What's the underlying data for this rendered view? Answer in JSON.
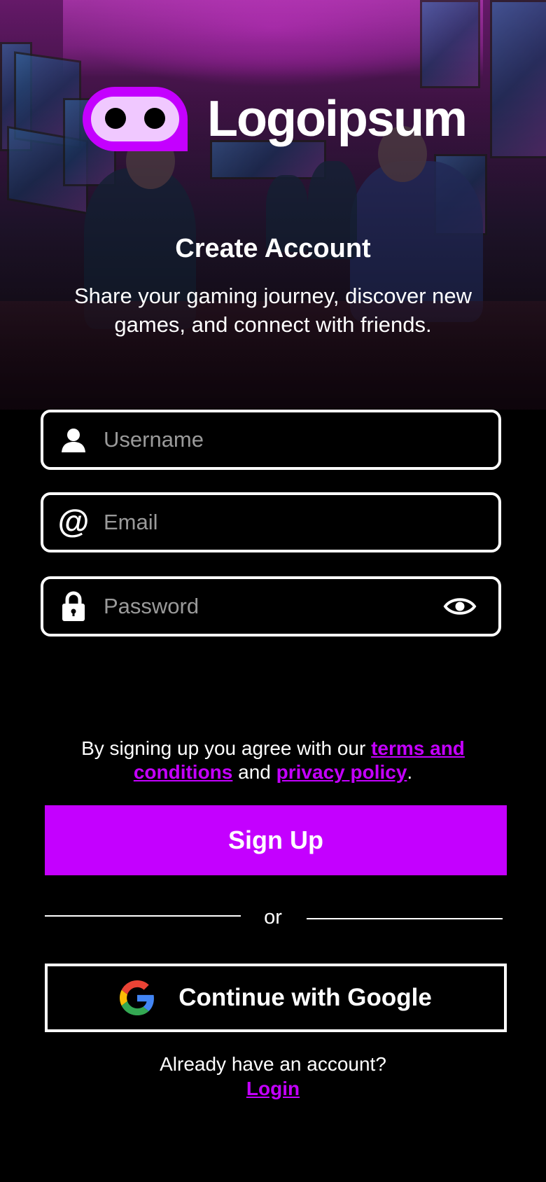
{
  "brand": {
    "name": "Logoipsum",
    "accent_color": "#c400ff",
    "logo_icon": "logo-mascot-icon"
  },
  "header": {
    "title": "Create Account",
    "subtitle": "Share your gaming journey, discover new games, and connect with friends."
  },
  "form": {
    "username": {
      "placeholder": "Username",
      "value": "",
      "icon": "user-icon"
    },
    "email": {
      "placeholder": "Email",
      "value": "",
      "icon": "at-icon"
    },
    "password": {
      "placeholder": "Password",
      "value": "",
      "icon": "lock-icon",
      "toggle_icon": "eye-icon"
    }
  },
  "terms": {
    "prefix": "By signing up you agree with our ",
    "terms_link": "terms and conditions",
    "middle": " and ",
    "privacy_link": "privacy policy",
    "suffix": "."
  },
  "actions": {
    "signup_label": "Sign Up",
    "or_label": "or",
    "google_label": "Continue with Google",
    "google_icon": "google-icon"
  },
  "footer": {
    "prompt": "Already have an account?",
    "login_label": "Login"
  }
}
